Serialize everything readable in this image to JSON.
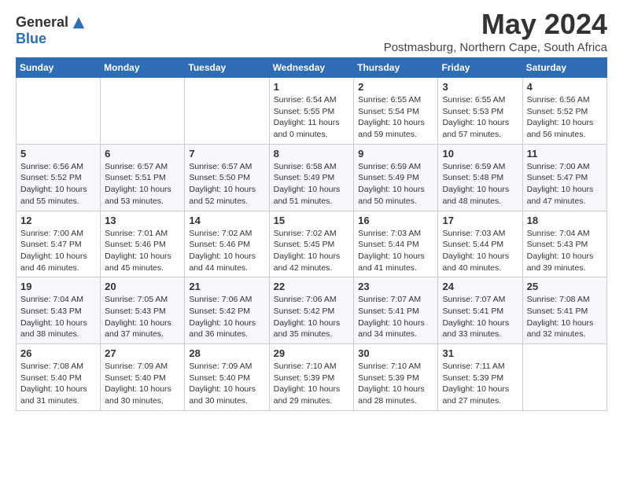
{
  "logo": {
    "general": "General",
    "blue": "Blue"
  },
  "title": {
    "month_year": "May 2024",
    "location": "Postmasburg, Northern Cape, South Africa"
  },
  "headers": [
    "Sunday",
    "Monday",
    "Tuesday",
    "Wednesday",
    "Thursday",
    "Friday",
    "Saturday"
  ],
  "weeks": [
    [
      {
        "day": "",
        "info": ""
      },
      {
        "day": "",
        "info": ""
      },
      {
        "day": "",
        "info": ""
      },
      {
        "day": "1",
        "info": "Sunrise: 6:54 AM\nSunset: 5:55 PM\nDaylight: 11 hours\nand 0 minutes."
      },
      {
        "day": "2",
        "info": "Sunrise: 6:55 AM\nSunset: 5:54 PM\nDaylight: 10 hours\nand 59 minutes."
      },
      {
        "day": "3",
        "info": "Sunrise: 6:55 AM\nSunset: 5:53 PM\nDaylight: 10 hours\nand 57 minutes."
      },
      {
        "day": "4",
        "info": "Sunrise: 6:56 AM\nSunset: 5:52 PM\nDaylight: 10 hours\nand 56 minutes."
      }
    ],
    [
      {
        "day": "5",
        "info": "Sunrise: 6:56 AM\nSunset: 5:52 PM\nDaylight: 10 hours\nand 55 minutes."
      },
      {
        "day": "6",
        "info": "Sunrise: 6:57 AM\nSunset: 5:51 PM\nDaylight: 10 hours\nand 53 minutes."
      },
      {
        "day": "7",
        "info": "Sunrise: 6:57 AM\nSunset: 5:50 PM\nDaylight: 10 hours\nand 52 minutes."
      },
      {
        "day": "8",
        "info": "Sunrise: 6:58 AM\nSunset: 5:49 PM\nDaylight: 10 hours\nand 51 minutes."
      },
      {
        "day": "9",
        "info": "Sunrise: 6:59 AM\nSunset: 5:49 PM\nDaylight: 10 hours\nand 50 minutes."
      },
      {
        "day": "10",
        "info": "Sunrise: 6:59 AM\nSunset: 5:48 PM\nDaylight: 10 hours\nand 48 minutes."
      },
      {
        "day": "11",
        "info": "Sunrise: 7:00 AM\nSunset: 5:47 PM\nDaylight: 10 hours\nand 47 minutes."
      }
    ],
    [
      {
        "day": "12",
        "info": "Sunrise: 7:00 AM\nSunset: 5:47 PM\nDaylight: 10 hours\nand 46 minutes."
      },
      {
        "day": "13",
        "info": "Sunrise: 7:01 AM\nSunset: 5:46 PM\nDaylight: 10 hours\nand 45 minutes."
      },
      {
        "day": "14",
        "info": "Sunrise: 7:02 AM\nSunset: 5:46 PM\nDaylight: 10 hours\nand 44 minutes."
      },
      {
        "day": "15",
        "info": "Sunrise: 7:02 AM\nSunset: 5:45 PM\nDaylight: 10 hours\nand 42 minutes."
      },
      {
        "day": "16",
        "info": "Sunrise: 7:03 AM\nSunset: 5:44 PM\nDaylight: 10 hours\nand 41 minutes."
      },
      {
        "day": "17",
        "info": "Sunrise: 7:03 AM\nSunset: 5:44 PM\nDaylight: 10 hours\nand 40 minutes."
      },
      {
        "day": "18",
        "info": "Sunrise: 7:04 AM\nSunset: 5:43 PM\nDaylight: 10 hours\nand 39 minutes."
      }
    ],
    [
      {
        "day": "19",
        "info": "Sunrise: 7:04 AM\nSunset: 5:43 PM\nDaylight: 10 hours\nand 38 minutes."
      },
      {
        "day": "20",
        "info": "Sunrise: 7:05 AM\nSunset: 5:43 PM\nDaylight: 10 hours\nand 37 minutes."
      },
      {
        "day": "21",
        "info": "Sunrise: 7:06 AM\nSunset: 5:42 PM\nDaylight: 10 hours\nand 36 minutes."
      },
      {
        "day": "22",
        "info": "Sunrise: 7:06 AM\nSunset: 5:42 PM\nDaylight: 10 hours\nand 35 minutes."
      },
      {
        "day": "23",
        "info": "Sunrise: 7:07 AM\nSunset: 5:41 PM\nDaylight: 10 hours\nand 34 minutes."
      },
      {
        "day": "24",
        "info": "Sunrise: 7:07 AM\nSunset: 5:41 PM\nDaylight: 10 hours\nand 33 minutes."
      },
      {
        "day": "25",
        "info": "Sunrise: 7:08 AM\nSunset: 5:41 PM\nDaylight: 10 hours\nand 32 minutes."
      }
    ],
    [
      {
        "day": "26",
        "info": "Sunrise: 7:08 AM\nSunset: 5:40 PM\nDaylight: 10 hours\nand 31 minutes."
      },
      {
        "day": "27",
        "info": "Sunrise: 7:09 AM\nSunset: 5:40 PM\nDaylight: 10 hours\nand 30 minutes."
      },
      {
        "day": "28",
        "info": "Sunrise: 7:09 AM\nSunset: 5:40 PM\nDaylight: 10 hours\nand 30 minutes."
      },
      {
        "day": "29",
        "info": "Sunrise: 7:10 AM\nSunset: 5:39 PM\nDaylight: 10 hours\nand 29 minutes."
      },
      {
        "day": "30",
        "info": "Sunrise: 7:10 AM\nSunset: 5:39 PM\nDaylight: 10 hours\nand 28 minutes."
      },
      {
        "day": "31",
        "info": "Sunrise: 7:11 AM\nSunset: 5:39 PM\nDaylight: 10 hours\nand 27 minutes."
      },
      {
        "day": "",
        "info": ""
      }
    ]
  ]
}
